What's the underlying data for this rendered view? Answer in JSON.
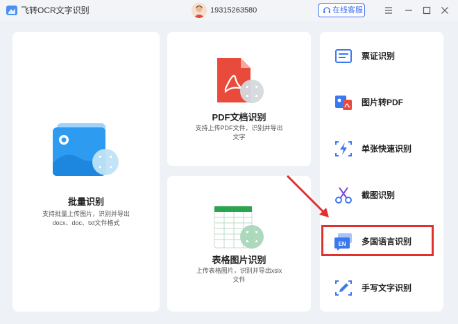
{
  "app": {
    "title": "飞转OCR文字识别",
    "user_phone": "19315263580",
    "service_label": "在线客服"
  },
  "cards": {
    "batch": {
      "title": "批量识别",
      "desc_line1": "支持批量上传图片，识别并导出",
      "desc_line2": "docx、doc、txt文件格式"
    },
    "pdf": {
      "title": "PDF文档识别",
      "desc_line1": "支持上传PDF文件，识别并导出",
      "desc_line2": "文字"
    },
    "table": {
      "title": "表格图片识别",
      "desc_line1": "上传表格图片，识别并导出xslx",
      "desc_line2": "文件"
    }
  },
  "tools": [
    {
      "label": "票证识别",
      "icon": "id-card-icon"
    },
    {
      "label": "图片转PDF",
      "icon": "image-to-pdf-icon"
    },
    {
      "label": "单张快速识别",
      "icon": "lightning-icon"
    },
    {
      "label": "截图识别",
      "icon": "scissors-icon"
    },
    {
      "label": "多国语言识别",
      "icon": "en-language-icon"
    },
    {
      "label": "手写文字识别",
      "icon": "pen-icon"
    }
  ],
  "colors": {
    "accent": "#3b6cf0",
    "highlight": "#e03030",
    "background": "#eef1f6"
  }
}
